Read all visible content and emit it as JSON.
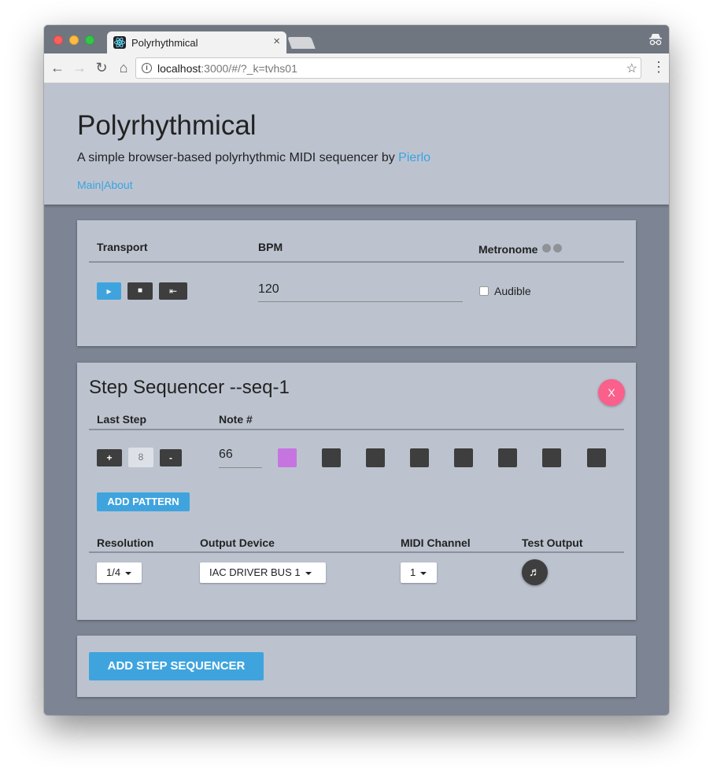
{
  "browser": {
    "tab_title": "Polyrhythmical",
    "tab_close": "×",
    "url_host": "localhost",
    "url_path": ":3000/#/?_k=tvhs01"
  },
  "header": {
    "title": "Polyrhythmical",
    "tagline_prefix": "A simple browser-based polyrhythmic MIDI sequencer by ",
    "tagline_link": "Pierlo",
    "nav": [
      {
        "label": "Main"
      },
      {
        "label": "About"
      }
    ],
    "nav_separator": "|"
  },
  "transport_card": {
    "transport_label": "Transport",
    "bpm_label": "BPM",
    "metronome_label": "Metronome",
    "play_icon": "▸",
    "stop_icon": "■",
    "rewind_icon": "⇤",
    "bpm_value": "120",
    "audible_label": "Audible",
    "audible_checked": false
  },
  "sequencer": {
    "title": "Step Sequencer --seq-1",
    "close_label": "X",
    "last_step_label": "Last Step",
    "note_label": "Note #",
    "plus_label": "+",
    "minus_label": "-",
    "last_step_value": "8",
    "note_value": "66",
    "steps": [
      true,
      false,
      false,
      false,
      false,
      false,
      false,
      false
    ],
    "add_pattern_label": "ADD PATTERN",
    "resolution_label": "Resolution",
    "output_device_label": "Output Device",
    "midi_channel_label": "MIDI Channel",
    "test_output_label": "Test Output",
    "resolution_value": "1/4",
    "output_device_value": "IAC DRIVER BUS 1",
    "midi_channel_value": "1",
    "test_output_icon": "♬"
  },
  "add_sequencer_label": "ADD STEP SEQUENCER",
  "colors": {
    "accent": "#3fa4de",
    "active_step": "#c675e0",
    "close_button": "#fb5f8b"
  }
}
